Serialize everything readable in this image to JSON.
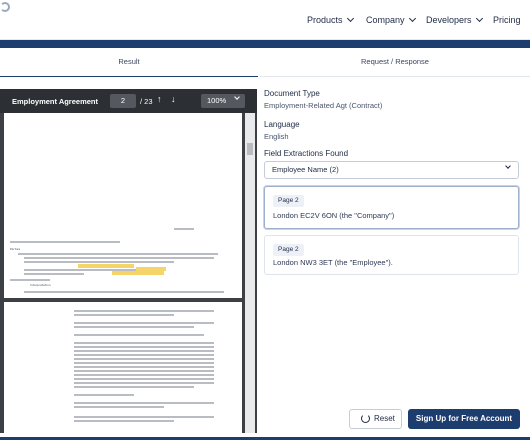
{
  "nav": {
    "products": "Products",
    "company": "Company",
    "developers": "Developers",
    "pricing": "Pricing"
  },
  "tabs": {
    "result": "Result",
    "request": "Request / Response"
  },
  "viewer": {
    "title": "Employment Agreement",
    "page_current": "2",
    "page_total": "/ 23",
    "zoom": "100%"
  },
  "doc": {
    "line_parties": "Parties",
    "line_interpretation": "Interpretation"
  },
  "info": {
    "doc_type_label": "Document Type",
    "doc_type_value": "Employment-Related Agt (Contract)",
    "language_label": "Language",
    "language_value": "English",
    "fields_label": "Field Extractions Found",
    "field_select": "Employee Name (2)"
  },
  "results": [
    {
      "page": "Page 2",
      "text": "London EC2V 6ON (the \"Company\")"
    },
    {
      "page": "Page 2",
      "text": "London NW3 3ET (the \"Employee\")."
    }
  ],
  "actions": {
    "reset": "Reset",
    "signup": "Sign Up for Free Account"
  },
  "colors": {
    "brand_navy": "#1d3d6e",
    "highlight": "#f5d56a"
  }
}
